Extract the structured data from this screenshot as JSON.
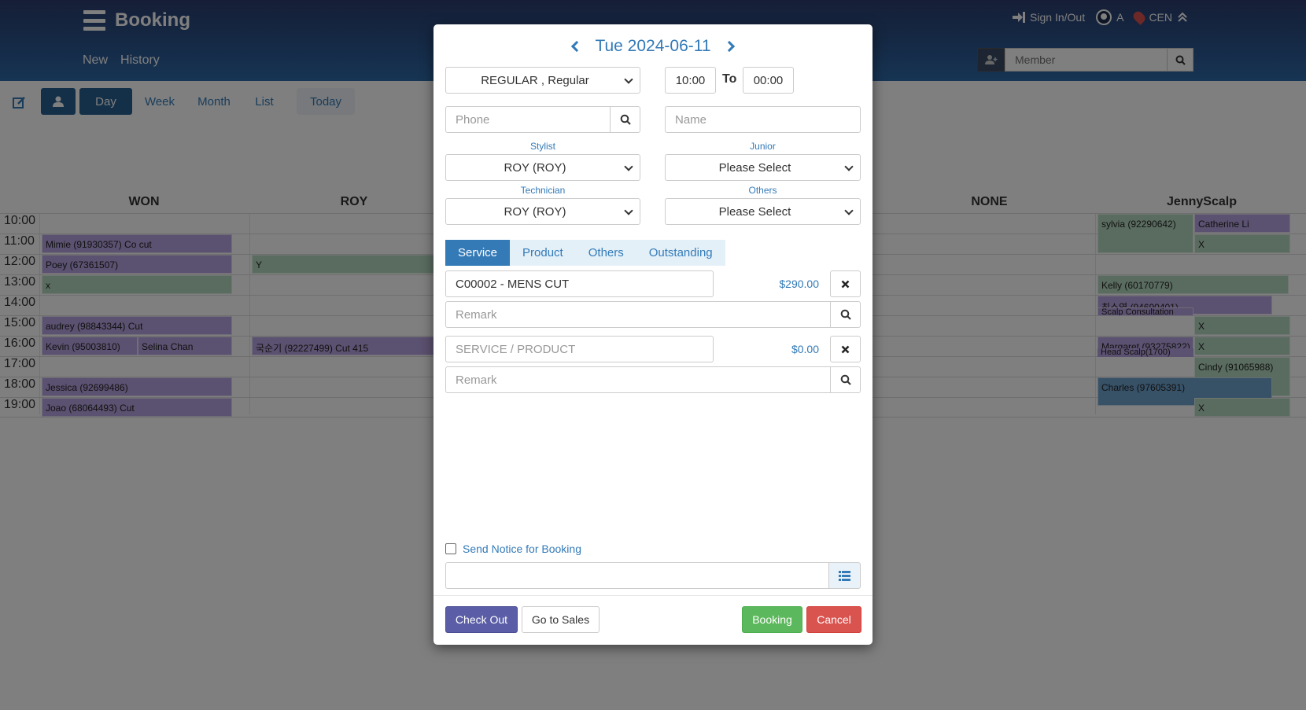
{
  "header": {
    "app_title": "Booking",
    "nav": [
      "New",
      "History"
    ],
    "sign_in_out": "Sign In/Out",
    "user_initial": "A",
    "location": "CEN",
    "member_placeholder": "Member"
  },
  "toolbar": {
    "views": [
      "Day",
      "Week",
      "Month",
      "List"
    ],
    "today": "Today"
  },
  "calendar": {
    "columns": [
      "WON",
      "ROY",
      "NONE",
      "JennyScalp"
    ],
    "times": [
      "10:00",
      "11:00",
      "12:00",
      "13:00",
      "14:00",
      "15:00",
      "16:00",
      "17:00",
      "18:00",
      "19:00"
    ],
    "events": [
      "Mimie (91930357) Co cut",
      "Poey (67361507)",
      "x",
      "audrey (98843344) Cut",
      "Kevin (95003810)",
      "Selina Chan",
      "Jessica (92699486)",
      "Joao (68064493) Cut",
      "Y",
      "국순기 (92227499) Cut 415",
      "sylvia (92290642)",
      "Catherine Li",
      "X",
      "Kelly (60170779)",
      "최소영 (94690401)",
      "Scalp Consultation",
      "X",
      "Margaret (93275822)",
      "Head Scalp(1700)",
      "X",
      "Cindy (91065988)",
      "Charles (97605391)",
      "X"
    ]
  },
  "modal": {
    "date": "Tue 2024-06-11",
    "booking_type": "REGULAR , Regular",
    "time_from": "10:00",
    "to_label": "To",
    "time_to": "00:00",
    "phone_placeholder": "Phone",
    "name_placeholder": "Name",
    "stylist_label": "Stylist",
    "stylist_value": "ROY (ROY)",
    "junior_label": "Junior",
    "junior_value": "Please Select",
    "technician_label": "Technician",
    "technician_value": "ROY (ROY)",
    "others_label": "Others",
    "others_value": "Please Select",
    "tabs": [
      "Service",
      "Product",
      "Others",
      "Outstanding"
    ],
    "service1": "C00002 - MENS CUT",
    "service1_price": "$290.00",
    "remark_placeholder": "Remark",
    "service2_placeholder": "SERVICE / PRODUCT",
    "service2_price": "$0.00",
    "send_notice": "Send Notice for Booking",
    "buttons": {
      "checkout": "Check Out",
      "go_to_sales": "Go to Sales",
      "booking": "Booking",
      "cancel": "Cancel"
    }
  },
  "colors": {
    "header_blue": "#2a4f86",
    "link_blue": "#337ab7",
    "event_purple": "#b7a3e0",
    "event_green": "#b4d8c0",
    "checkout_purple": "#5b5ea6",
    "booking_green": "#5cb85c",
    "cancel_red": "#d9534f"
  }
}
